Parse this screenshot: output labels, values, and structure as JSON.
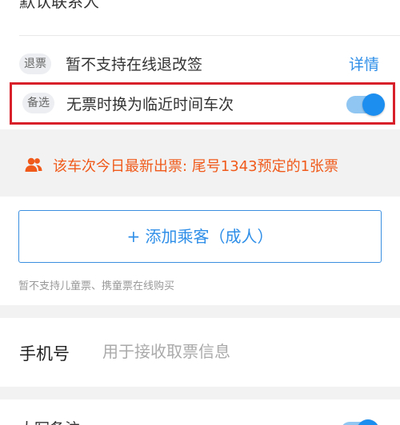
{
  "top_partial": {
    "clipped_text": "默认联系人"
  },
  "refund_row": {
    "tag": "退票",
    "text": "暂不支持在线退改签",
    "link": "详情"
  },
  "alternate_row": {
    "tag": "备选",
    "text": "无票时换为临近时间车次",
    "toggle_on": true
  },
  "notice": {
    "icon": "person-group-icon",
    "text": "该车次今日最新出票: 尾号1343预定的1张票",
    "color": "#f05a1a"
  },
  "passengers": {
    "add_button": "+ 添加乘客（成人）",
    "note": "暂不支持儿童票、携童票在线购买"
  },
  "phone": {
    "label": "手机号",
    "placeholder": "用于接收取票信息"
  },
  "bottom_partial": {
    "text": "大写备注",
    "toggle_on": true
  },
  "colors": {
    "accent": "#2f8fe8",
    "highlight_border": "#d8202a",
    "notice": "#f05a1a"
  }
}
